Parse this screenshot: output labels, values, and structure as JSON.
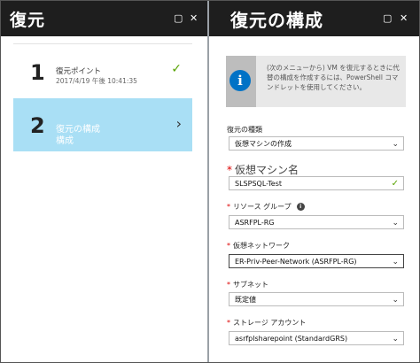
{
  "left_blade": {
    "title": "復元",
    "steps": [
      {
        "number": "1",
        "title": "復元ポイント",
        "subtitle": "2017/4/19 午後 10:41:35"
      },
      {
        "number": "2",
        "title_line1": "復元の構成",
        "title_line2": "構成"
      }
    ]
  },
  "right_blade": {
    "title": "復元の構成",
    "info_text": "(次のメニューから) VM を復元するときに代替の構成を作成するには、PowerShell コマンドレットを使用してください。",
    "fields": {
      "restore_type": {
        "label": "復元の種類",
        "value": "仮想マシンの作成"
      },
      "vm_name": {
        "label": "仮想マシン名",
        "value": "SLSPSQL-Test"
      },
      "resource_group": {
        "label": "リソース グループ",
        "value": "ASRFPL-RG"
      },
      "virtual_network": {
        "label": "仮想ネットワーク",
        "value": "ER-Priv-Peer-Network (ASRFPL-RG)"
      },
      "subnet": {
        "label": "サブネット",
        "value": "既定値"
      },
      "storage_account": {
        "label": "ストレージ アカウント",
        "value": "asrfplsharepoint (StandardGRS)"
      }
    }
  },
  "icons": {
    "maximize": "maximize-icon",
    "close": "close-icon",
    "check": "check-icon",
    "chevron_right": "chevron-right-icon",
    "chevron_down": "chevron-down-icon",
    "info": "info-icon"
  },
  "colors": {
    "title_bar": "#1e1e1e",
    "selected_step": "#a9dff5",
    "check": "#57a300",
    "info_icon": "#0072c6",
    "required": "#dd0000"
  }
}
